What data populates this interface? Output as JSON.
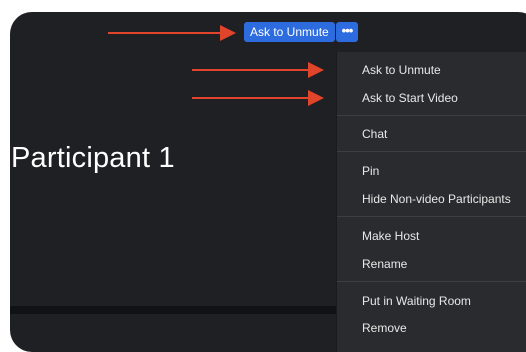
{
  "participant": {
    "name": "Participant 1"
  },
  "toolbar": {
    "ask_unmute_label": "Ask to Unmute",
    "more_label": "•••"
  },
  "menu": {
    "items": [
      {
        "label": "Ask to Unmute"
      },
      {
        "label": "Ask to Start Video"
      },
      {
        "label": "Chat"
      },
      {
        "label": "Pin"
      },
      {
        "label": "Hide Non-video Participants"
      },
      {
        "label": "Make Host"
      },
      {
        "label": "Rename"
      },
      {
        "label": "Put in Waiting Room"
      },
      {
        "label": "Remove"
      }
    ]
  },
  "colors": {
    "accent": "#2d6cdf",
    "arrow": "#e0442a",
    "background": "#1f2023",
    "menu_bg": "#2a2b2f"
  }
}
